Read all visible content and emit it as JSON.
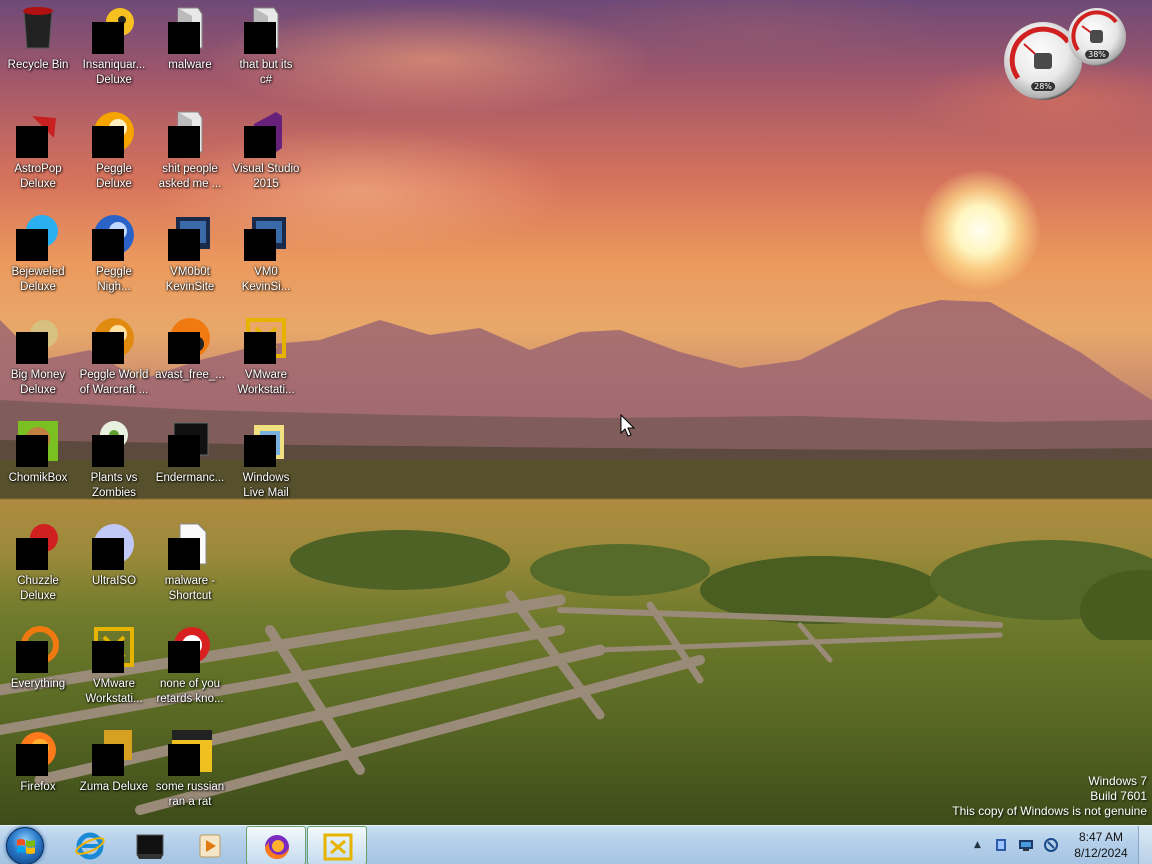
{
  "desktop_icons": [
    {
      "label": "Recycle Bin",
      "icon": "recycle-bin-icon"
    },
    {
      "label": "Insaniquar...\nDeluxe",
      "icon": "insaniquarium-icon"
    },
    {
      "label": "malware",
      "icon": "folder-icon"
    },
    {
      "label": "that but its\nc#",
      "icon": "folder-icon"
    },
    {
      "label": "AstroPop\nDeluxe",
      "icon": "astropop-icon"
    },
    {
      "label": "Peggle\nDeluxe",
      "icon": "peggle-icon"
    },
    {
      "label": "shit people\nasked me ...",
      "icon": "folder-icon"
    },
    {
      "label": "Visual Studio\n2015",
      "icon": "visual-studio-icon"
    },
    {
      "label": "Bejeweled\nDeluxe",
      "icon": "bejeweled-icon"
    },
    {
      "label": "Peggle\nNigh...",
      "icon": "peggle-nights-icon"
    },
    {
      "label": "VM0b0t\nKevinSite",
      "icon": "vm-shortcut-icon"
    },
    {
      "label": "VM0\nKevinSi...",
      "icon": "vm-shortcut-icon"
    },
    {
      "label": "Big Money\nDeluxe",
      "icon": "big-money-icon"
    },
    {
      "label": "Peggle World\nof Warcraft ...",
      "icon": "peggle-wow-icon"
    },
    {
      "label": "avast_free_...",
      "icon": "avast-icon"
    },
    {
      "label": "VMware\nWorkstati...",
      "icon": "vmware-icon"
    },
    {
      "label": "ChomikBox",
      "icon": "chomikbox-icon"
    },
    {
      "label": "Plants vs\nZombies",
      "icon": "plants-vs-zombies-icon"
    },
    {
      "label": "Endermanc...",
      "icon": "terminal-icon"
    },
    {
      "label": "Windows\nLive Mail",
      "icon": "live-mail-icon"
    },
    {
      "label": "Chuzzle\nDeluxe",
      "icon": "chuzzle-icon"
    },
    {
      "label": "UltraISO",
      "icon": "ultraiso-icon"
    },
    {
      "label": "malware -\nShortcut",
      "icon": "file-shortcut-icon"
    },
    {
      "label": "Everything",
      "icon": "everything-search-icon"
    },
    {
      "label": "VMware\nWorkstati...",
      "icon": "vmware-icon"
    },
    {
      "label": "none of you\nretards kno...",
      "icon": "red-app-icon"
    },
    {
      "label": "Firefox",
      "icon": "firefox-icon"
    },
    {
      "label": "Zuma Deluxe",
      "icon": "zuma-icon"
    },
    {
      "label": "some russian\nran a rat",
      "icon": "yellow-app-icon"
    }
  ],
  "gadgets": {
    "cpu_percent": "28%",
    "memory_percent": "38%"
  },
  "watermark": {
    "line1": "Windows 7",
    "line2": "Build 7601",
    "line3": "This copy of Windows is not genuine"
  },
  "taskbar": {
    "pinned": [
      {
        "name": "internet-explorer",
        "icon": "internet-explorer-icon"
      },
      {
        "name": "terminal",
        "icon": "terminal-icon"
      },
      {
        "name": "media-player",
        "icon": "media-player-icon"
      },
      {
        "name": "firefox",
        "icon": "firefox-icon",
        "active": true
      },
      {
        "name": "vmware",
        "icon": "vmware-icon",
        "active": true
      }
    ],
    "tray_icons": [
      "show-hidden-icons-arrow",
      "action-center-icon",
      "network-icon",
      "volume-icon"
    ]
  },
  "clock": {
    "time": "8:47 AM",
    "date": "8/12/2024"
  },
  "colors": {
    "taskbar": "#b5d0ea",
    "icon_placeholder": "#000000",
    "label_text": "#ffffff"
  }
}
